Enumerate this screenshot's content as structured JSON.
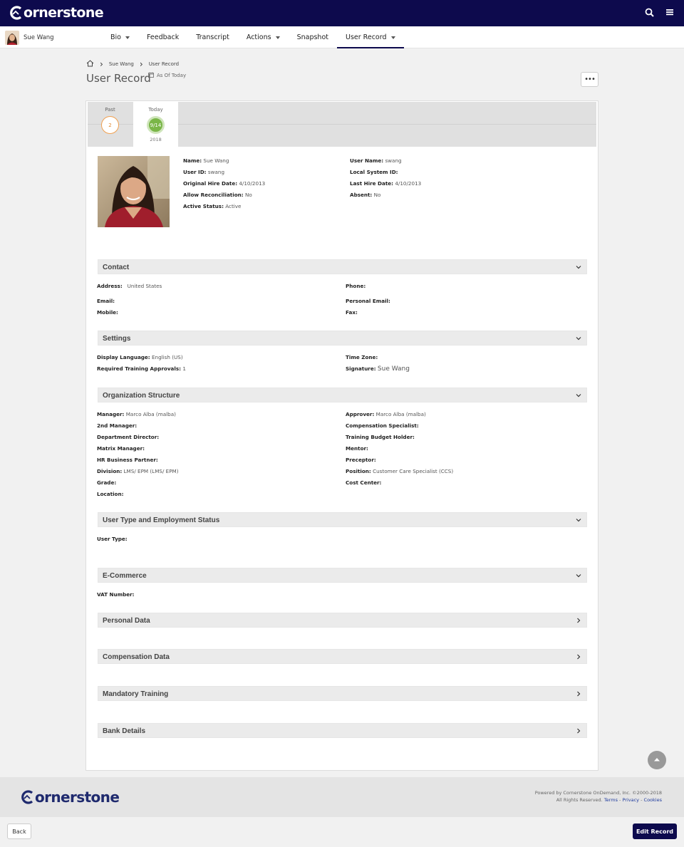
{
  "brand": {
    "name": "ornerstone",
    "primary": "#0d0a4d",
    "accent": "#7ab648"
  },
  "top_icons": [
    "search-icon",
    "menu-icon"
  ],
  "user": {
    "name": "Sue Wang"
  },
  "nav": {
    "tabs": [
      {
        "label": "Bio",
        "dropdown": true
      },
      {
        "label": "Feedback",
        "dropdown": false
      },
      {
        "label": "Transcript",
        "dropdown": false
      },
      {
        "label": "Actions",
        "dropdown": true
      },
      {
        "label": "Snapshot",
        "dropdown": false
      },
      {
        "label": "User Record",
        "dropdown": true,
        "active": true
      }
    ]
  },
  "breadcrumb": {
    "home_icon": "home-icon",
    "items": [
      "Sue Wang",
      "User Record"
    ]
  },
  "page": {
    "title": "User Record",
    "as_of": "As Of Today",
    "more_label": "•••"
  },
  "timeline": {
    "past": {
      "label": "Past",
      "count": "2"
    },
    "today": {
      "label": "Today",
      "date": "9/14",
      "year": "2018"
    }
  },
  "profile": {
    "left": [
      {
        "label": "Name:",
        "value": "Sue Wang"
      },
      {
        "label": "User ID:",
        "value": "swang"
      },
      {
        "label": "Original Hire Date:",
        "value": "4/10/2013"
      },
      {
        "label": "Allow Reconciliation:",
        "value": "No"
      },
      {
        "label": "Active Status:",
        "value": "Active"
      }
    ],
    "right": [
      {
        "label": "User Name:",
        "value": "swang"
      },
      {
        "label": "Local System ID:",
        "value": ""
      },
      {
        "label": "Last Hire Date:",
        "value": "4/10/2013"
      },
      {
        "label": "Absent:",
        "value": "No"
      }
    ]
  },
  "sections": {
    "contact": {
      "title": "Contact",
      "address_label": "Address:",
      "address_value": "United States",
      "phone_label": "Phone:",
      "email_label": "Email:",
      "personal_email_label": "Personal Email:",
      "mobile_label": "Mobile:",
      "fax_label": "Fax:"
    },
    "settings": {
      "title": "Settings",
      "display_language_label": "Display Language:",
      "display_language_value": "English (US)",
      "time_zone_label": "Time Zone:",
      "required_training_label": "Required Training Approvals:",
      "required_training_value": "1",
      "signature_label": "Signature:",
      "signature_value": "Sue Wang"
    },
    "org": {
      "title": "Organization Structure",
      "left": [
        {
          "label": "Manager:",
          "value": "Marco Alba (malba)"
        },
        {
          "label": "2nd Manager:",
          "value": ""
        },
        {
          "label": "Department Director:",
          "value": ""
        },
        {
          "label": "Matrix Manager:",
          "value": ""
        },
        {
          "label": "HR Business Partner:",
          "value": ""
        },
        {
          "label": "Division:",
          "value": "LMS/ EPM (LMS/ EPM)"
        },
        {
          "label": "Grade:",
          "value": ""
        },
        {
          "label": "Location:",
          "value": ""
        }
      ],
      "right": [
        {
          "label": "Approver:",
          "value": "Marco Alba (malba)"
        },
        {
          "label": "Compensation Specialist:",
          "value": ""
        },
        {
          "label": "Training Budget Holder:",
          "value": ""
        },
        {
          "label": "Mentor:",
          "value": ""
        },
        {
          "label": "Preceptor:",
          "value": ""
        },
        {
          "label": "Position:",
          "value": "Customer Care Specialist (CCS)"
        },
        {
          "label": "Cost Center:",
          "value": ""
        }
      ]
    },
    "user_type": {
      "title": "User Type and Employment Status",
      "user_type_label": "User Type:"
    },
    "ecommerce": {
      "title": "E-Commerce",
      "vat_label": "VAT Number:"
    },
    "personal_data": {
      "title": "Personal Data"
    },
    "compensation_data": {
      "title": "Compensation Data"
    },
    "mandatory_training": {
      "title": "Mandatory Training"
    },
    "bank_details": {
      "title": "Bank Details"
    }
  },
  "footer": {
    "powered_by": "Powered by Cornerstone OnDemand, Inc. ©2000-2018",
    "rights": "All Rights Reserved.",
    "terms": "Terms",
    "privacy": "Privacy",
    "cookies": "Cookies",
    "dash": "-"
  },
  "actions": {
    "back": "Back",
    "edit": "Edit Record"
  }
}
